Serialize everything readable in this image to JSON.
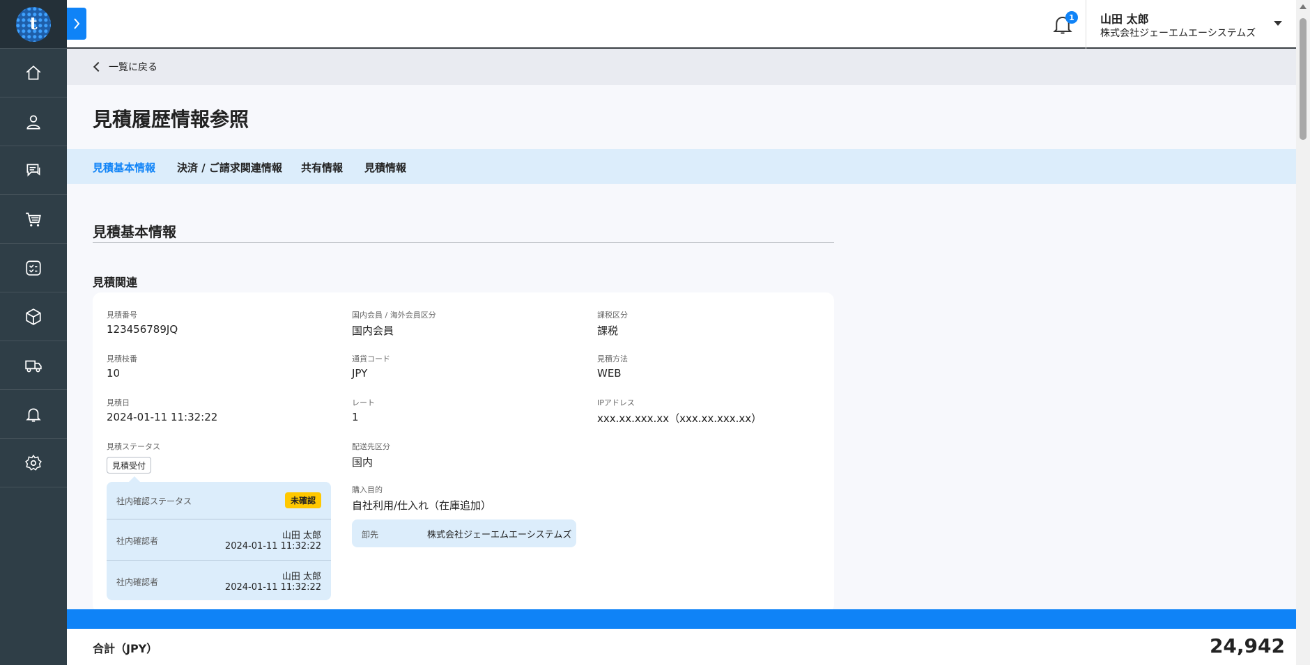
{
  "header": {
    "notification_count": "1",
    "user_name": "山田 太郎",
    "user_company": "株式会社ジェーエムエーシステムズ"
  },
  "back_link": "一覧に戻る",
  "page_title": "見積履歴情報参照",
  "tabs": [
    {
      "label": "見積基本情報",
      "active": true
    },
    {
      "label": "決済 / ご請求関連情報",
      "active": false
    },
    {
      "label": "共有情報",
      "active": false
    },
    {
      "label": "見積情報",
      "active": false
    }
  ],
  "section_title": "見積基本情報",
  "subsection_title": "見積関連",
  "fields": {
    "quote_number": {
      "label": "見積番号",
      "value": "123456789JQ"
    },
    "quote_branch": {
      "label": "見積枝番",
      "value": "10"
    },
    "quote_date": {
      "label": "見積日",
      "value": "2024-01-11 11:32:22"
    },
    "quote_status": {
      "label": "見積ステータス",
      "value": "見積受付"
    },
    "member_type": {
      "label": "国内会員 / 海外会員区分",
      "value": "国内会員"
    },
    "currency_code": {
      "label": "通貨コード",
      "value": "JPY"
    },
    "rate": {
      "label": "レート",
      "value": "1"
    },
    "delivery_type": {
      "label": "配送先区分",
      "value": "国内"
    },
    "purchase_purpose": {
      "label": "購入目的",
      "value": "自社利用/仕入れ（在庫追加）"
    },
    "tax_type": {
      "label": "課税区分",
      "value": "課税"
    },
    "quote_method": {
      "label": "見積方法",
      "value": "WEB"
    },
    "ip_address": {
      "label": "IPアドレス",
      "value": "xxx.xx.xxx.xx（xxx.xx.xxx.xx）"
    }
  },
  "internal_confirm": {
    "status_label": "社内確認ステータス",
    "status_value": "未確認",
    "confirmers": [
      {
        "label": "社内確認者",
        "name": "山田 太郎",
        "date": "2024-01-11 11:32:22"
      },
      {
        "label": "社内確認者",
        "name": "山田 太郎",
        "date": "2024-01-11 11:32:22"
      }
    ]
  },
  "wholesale": {
    "label": "卸先",
    "value": "株式会社ジェーエムエーシステムズ"
  },
  "footer": {
    "total_label": "合計（JPY）",
    "total_value": "24,942"
  },
  "colors": {
    "accent": "#0f83f7",
    "sidebar": "#2f3e47",
    "tab_bg": "#dcedfb",
    "badge_pending": "#ffc800"
  },
  "icons": {
    "sidebar": [
      "home-icon",
      "user-icon",
      "chat-icon",
      "cart-icon",
      "checklist-icon",
      "package-icon",
      "truck-icon",
      "bell-icon",
      "gear-icon"
    ]
  }
}
